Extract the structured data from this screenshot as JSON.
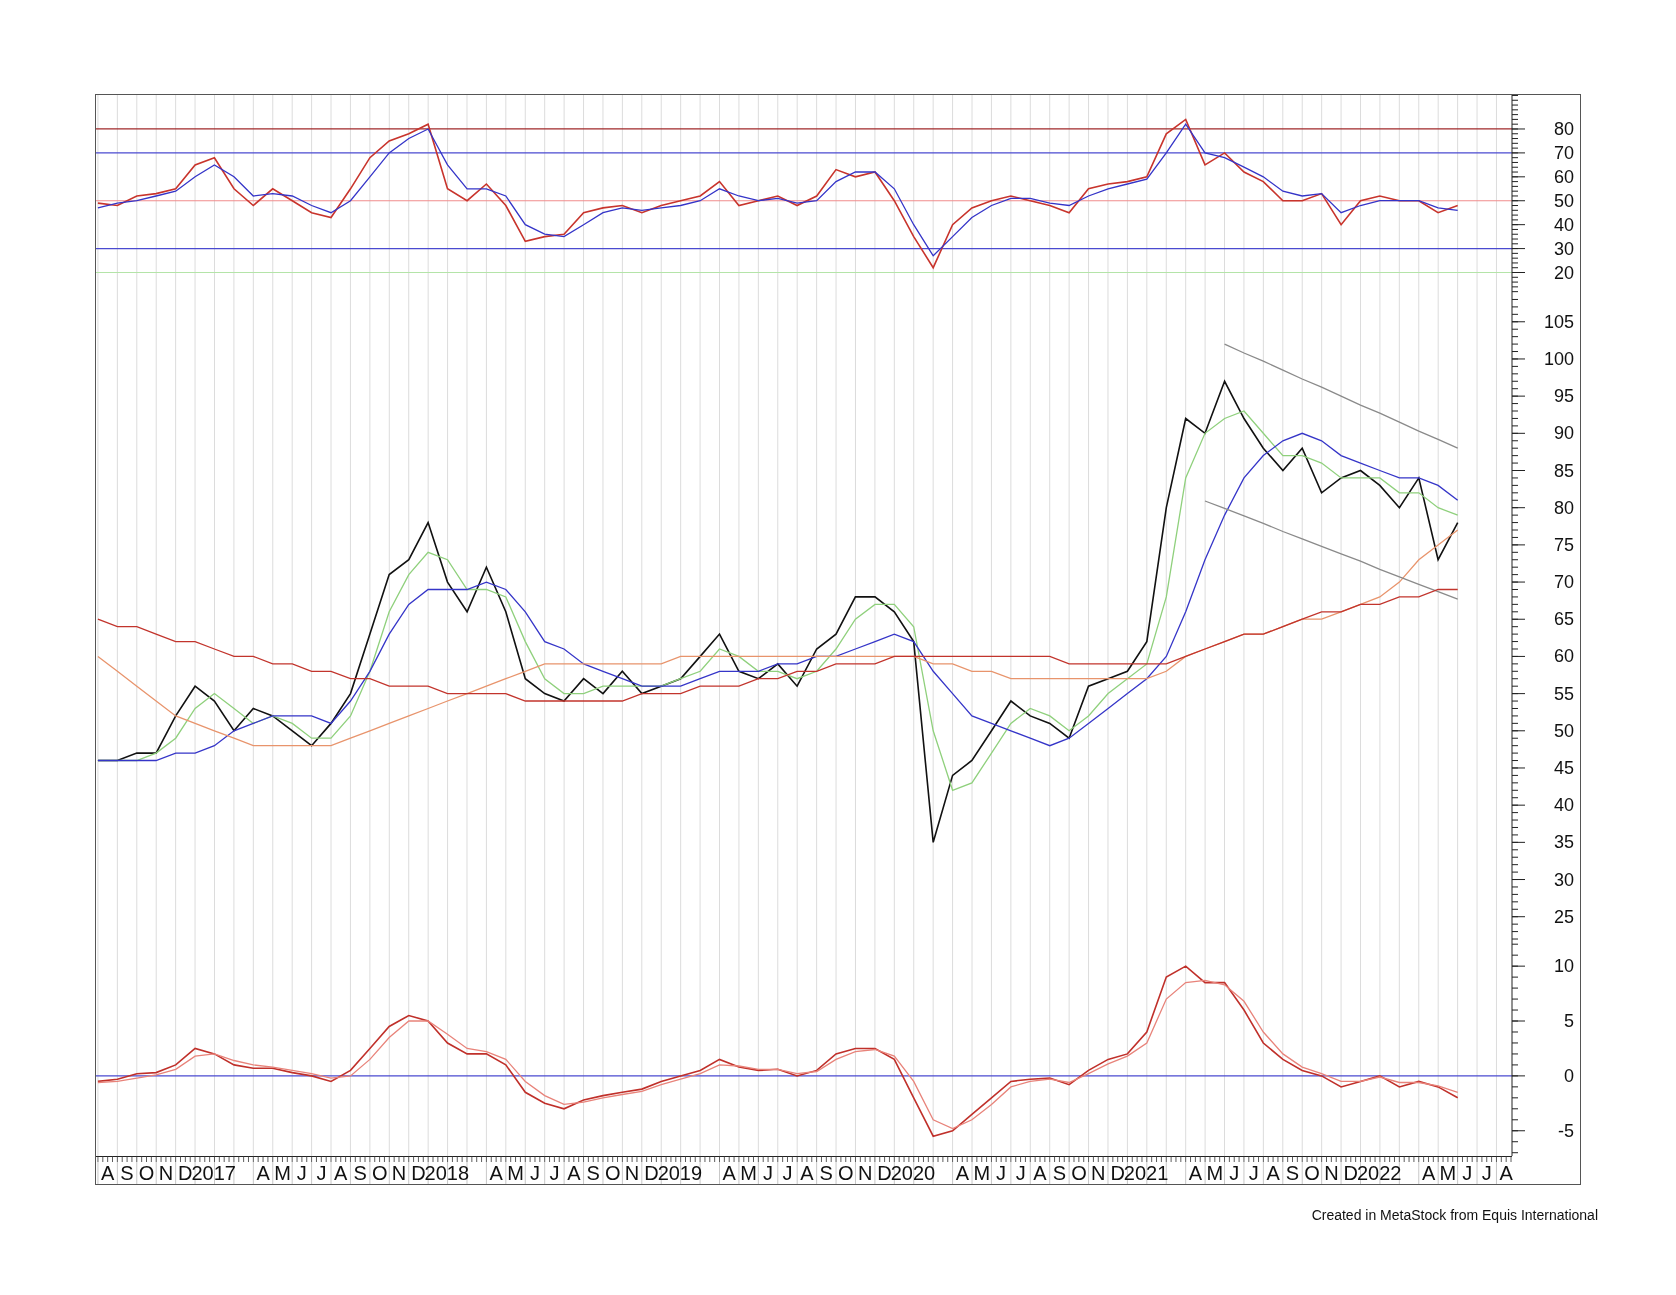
{
  "panels": [
    {
      "chart_data": {
        "type": "line",
        "x": [
          2016.583,
          2016.667,
          2016.75,
          2016.833,
          2016.917,
          2017.0,
          2017.083,
          2017.167,
          2017.25,
          2017.333,
          2017.417,
          2017.5,
          2017.583,
          2017.667,
          2017.75,
          2017.833,
          2017.917,
          2018.0,
          2018.083,
          2018.167,
          2018.25,
          2018.333,
          2018.417,
          2018.5,
          2018.583,
          2018.667,
          2018.75,
          2018.833,
          2018.917,
          2019.0,
          2019.083,
          2019.167,
          2019.25,
          2019.333,
          2019.417,
          2019.5,
          2019.583,
          2019.667,
          2019.75,
          2019.833,
          2019.917,
          2020.0,
          2020.083,
          2020.167,
          2020.25,
          2020.333,
          2020.417,
          2020.5,
          2020.583,
          2020.667,
          2020.75,
          2020.833,
          2020.917,
          2021.0,
          2021.083,
          2021.167,
          2021.25,
          2021.333,
          2021.417,
          2021.5,
          2021.583,
          2021.667,
          2021.75,
          2021.833,
          2021.917,
          2022.0,
          2022.083,
          2022.167,
          2022.25,
          2022.333,
          2022.417
        ],
        "xlim": [
          2016.575,
          2022.65
        ],
        "ylim": [
          10.6,
          94.2
        ],
        "yticks": [
          20,
          30,
          40,
          50,
          60,
          70,
          80
        ],
        "series": [
          {
            "color": "#c8342c",
            "values": [
              49,
              48,
              52,
              53,
              55,
              65,
              68,
              55,
              48,
              55,
              50,
              45,
              43,
              55,
              68,
              75,
              78,
              82,
              55,
              50,
              57,
              48,
              33,
              35,
              36,
              45,
              47,
              48,
              45,
              48,
              50,
              52,
              58,
              48,
              50,
              52,
              48,
              52,
              63,
              60,
              62,
              50,
              35,
              22,
              40,
              47,
              50,
              52,
              50,
              48,
              45,
              55,
              57,
              58,
              60,
              78,
              84,
              65,
              70,
              62,
              58,
              50,
              50,
              53,
              40,
              50,
              52,
              50,
              50,
              45,
              48
            ]
          },
          {
            "color": "#3434c8",
            "values": [
              47,
              49,
              50,
              52,
              54,
              60,
              65,
              60,
              52,
              53,
              52,
              48,
              45,
              50,
              60,
              70,
              76,
              80,
              65,
              55,
              55,
              52,
              40,
              36,
              35,
              40,
              45,
              47,
              46,
              47,
              48,
              50,
              55,
              52,
              50,
              51,
              49,
              50,
              58,
              62,
              62,
              55,
              40,
              27,
              35,
              43,
              48,
              51,
              51,
              49,
              48,
              52,
              55,
              57,
              59,
              70,
              82,
              70,
              68,
              64,
              60,
              54,
              52,
              53,
              45,
              48,
              50,
              50,
              50,
              47,
              46
            ]
          }
        ],
        "grid": true,
        "ref_lines": [
          {
            "axis": "y",
            "value": 80,
            "color": "#a0282a"
          },
          {
            "axis": "y",
            "value": 70,
            "color": "#4a4ad0"
          },
          {
            "axis": "y",
            "value": 50,
            "color": "#f08c8c"
          },
          {
            "axis": "y",
            "value": 30,
            "color": "#4a4ad0"
          },
          {
            "axis": "y",
            "value": 20,
            "color": "#b4e4a8"
          }
        ]
      }
    },
    {
      "chart_data": {
        "type": "line",
        "x": [
          2016.583,
          2016.667,
          2016.75,
          2016.833,
          2016.917,
          2017.0,
          2017.083,
          2017.167,
          2017.25,
          2017.333,
          2017.417,
          2017.5,
          2017.583,
          2017.667,
          2017.75,
          2017.833,
          2017.917,
          2018.0,
          2018.083,
          2018.167,
          2018.25,
          2018.333,
          2018.417,
          2018.5,
          2018.583,
          2018.667,
          2018.75,
          2018.833,
          2018.917,
          2019.0,
          2019.083,
          2019.167,
          2019.25,
          2019.333,
          2019.417,
          2019.5,
          2019.583,
          2019.667,
          2019.75,
          2019.833,
          2019.917,
          2020.0,
          2020.083,
          2020.167,
          2020.25,
          2020.333,
          2020.417,
          2020.5,
          2020.583,
          2020.667,
          2020.75,
          2020.833,
          2020.917,
          2021.0,
          2021.083,
          2021.167,
          2021.25,
          2021.333,
          2021.417,
          2021.5,
          2021.583,
          2021.667,
          2021.75,
          2021.833,
          2021.917,
          2022.0,
          2022.083,
          2022.167,
          2022.25,
          2022.333,
          2022.417
        ],
        "xlim": [
          2016.575,
          2022.65
        ],
        "ylim": [
          21.6,
          108.6
        ],
        "grid": true,
        "yticks": [
          25,
          30,
          35,
          40,
          45,
          50,
          55,
          60,
          65,
          70,
          75,
          80,
          85,
          90,
          95,
          100,
          105
        ],
        "series": [
          {
            "color": "#111111",
            "values": [
              46,
              46,
              47,
              47,
              52,
              56,
              54,
              50,
              53,
              52,
              50,
              48,
              51,
              55,
              63,
              71,
              73,
              78,
              70,
              66,
              72,
              66,
              57,
              55,
              54,
              57,
              55,
              58,
              55,
              56,
              57,
              60,
              63,
              58,
              57,
              59,
              56,
              61,
              63,
              68,
              68,
              66,
              62,
              35,
              44,
              46,
              50,
              54,
              52,
              51,
              49,
              56,
              57,
              58,
              62,
              80,
              92,
              90,
              97,
              92,
              88,
              85,
              88,
              82,
              84,
              85,
              83,
              80,
              84,
              73,
              78
            ]
          },
          {
            "color": "#8fd07c",
            "values": [
              46,
              46,
              46,
              47,
              49,
              53,
              55,
              53,
              51,
              52,
              51,
              49,
              49,
              52,
              58,
              66,
              71,
              74,
              73,
              69,
              69,
              68,
              62,
              57,
              55,
              55,
              56,
              56,
              56,
              56,
              57,
              58,
              61,
              60,
              58,
              58,
              57,
              58,
              61,
              65,
              67,
              67,
              64,
              50,
              42,
              43,
              47,
              51,
              53,
              52,
              50,
              52,
              55,
              57,
              59,
              68,
              84,
              90,
              92,
              93,
              90,
              87,
              87,
              86,
              84,
              84,
              84,
              82,
              82,
              80,
              79
            ]
          },
          {
            "color": "#3535c8",
            "values": [
              46,
              46,
              46,
              46,
              47,
              47,
              48,
              50,
              51,
              52,
              52,
              52,
              51,
              54,
              58,
              63,
              67,
              69,
              69,
              69,
              70,
              69,
              66,
              62,
              61,
              59,
              58,
              57,
              56,
              56,
              56,
              57,
              58,
              58,
              58,
              59,
              59,
              60,
              60,
              61,
              62,
              63,
              62,
              58,
              55,
              52,
              51,
              50,
              49,
              48,
              49,
              51,
              53,
              55,
              57,
              60,
              66,
              73,
              79,
              84,
              87,
              89,
              90,
              89,
              87,
              86,
              85,
              84,
              84,
              83,
              81
            ]
          },
          {
            "color": "#e8946c",
            "values": [
              60,
              58,
              56,
              54,
              52,
              51,
              50,
              49,
              48,
              48,
              48,
              48,
              48,
              49,
              50,
              51,
              52,
              53,
              54,
              55,
              56,
              57,
              58,
              59,
              59,
              59,
              59,
              59,
              59,
              59,
              60,
              60,
              60,
              60,
              60,
              60,
              60,
              60,
              60,
              60,
              60,
              60,
              60,
              59,
              59,
              58,
              58,
              57,
              57,
              57,
              57,
              57,
              57,
              57,
              57,
              58,
              60,
              61,
              62,
              63,
              63,
              64,
              65,
              65,
              66,
              67,
              68,
              70,
              73,
              75,
              77
            ]
          },
          {
            "color": "#8a8a8a",
            "values": [
              null,
              null,
              null,
              null,
              null,
              null,
              null,
              null,
              null,
              null,
              null,
              null,
              null,
              null,
              null,
              null,
              null,
              null,
              null,
              null,
              null,
              null,
              null,
              null,
              null,
              null,
              null,
              null,
              null,
              null,
              null,
              null,
              null,
              null,
              null,
              null,
              null,
              null,
              null,
              null,
              null,
              null,
              null,
              null,
              null,
              null,
              null,
              null,
              null,
              null,
              null,
              null,
              null,
              null,
              null,
              null,
              null,
              null,
              102.0,
              100.8,
              99.7,
              98.5,
              97.3,
              96.2,
              95.0,
              93.8,
              92.7,
              91.5,
              90.3,
              89.2,
              88.0
            ]
          },
          {
            "color": "#8a8a8a",
            "values": [
              null,
              null,
              null,
              null,
              null,
              null,
              null,
              null,
              null,
              null,
              null,
              null,
              null,
              null,
              null,
              null,
              null,
              null,
              null,
              null,
              null,
              null,
              null,
              null,
              null,
              null,
              null,
              null,
              null,
              null,
              null,
              null,
              null,
              null,
              null,
              null,
              null,
              null,
              null,
              null,
              null,
              null,
              null,
              null,
              null,
              null,
              null,
              null,
              null,
              null,
              null,
              null,
              null,
              null,
              null,
              null,
              null,
              80.9,
              79.9,
              78.9,
              77.9,
              76.8,
              75.8,
              74.8,
              73.8,
              72.8,
              71.7,
              70.7,
              69.7,
              68.7,
              67.7
            ]
          },
          {
            "color": "#c2342c",
            "values": [
              65,
              64,
              64,
              63,
              62,
              62,
              61,
              60,
              60,
              59,
              59,
              58,
              58,
              57,
              57,
              56,
              56,
              56,
              55,
              55,
              55,
              55,
              54,
              54,
              54,
              54,
              54,
              54,
              55,
              55,
              55,
              56,
              56,
              56,
              57,
              57,
              58,
              58,
              59,
              59,
              59,
              60,
              60,
              60,
              60,
              60,
              60,
              60,
              60,
              60,
              59,
              59,
              59,
              59,
              59,
              59,
              60,
              61,
              62,
              63,
              63,
              64,
              65,
              66,
              66,
              67,
              67,
              68,
              68,
              69,
              69
            ]
          }
        ]
      }
    },
    {
      "chart_data": {
        "type": "line",
        "x": [
          2016.583,
          2016.667,
          2016.75,
          2016.833,
          2016.917,
          2017.0,
          2017.083,
          2017.167,
          2017.25,
          2017.333,
          2017.417,
          2017.5,
          2017.583,
          2017.667,
          2017.75,
          2017.833,
          2017.917,
          2018.0,
          2018.083,
          2018.167,
          2018.25,
          2018.333,
          2018.417,
          2018.5,
          2018.583,
          2018.667,
          2018.75,
          2018.833,
          2018.917,
          2019.0,
          2019.083,
          2019.167,
          2019.25,
          2019.333,
          2019.417,
          2019.5,
          2019.583,
          2019.667,
          2019.75,
          2019.833,
          2019.917,
          2020.0,
          2020.083,
          2020.167,
          2020.25,
          2020.333,
          2020.417,
          2020.5,
          2020.583,
          2020.667,
          2020.75,
          2020.833,
          2020.917,
          2021.0,
          2021.083,
          2021.167,
          2021.25,
          2021.333,
          2021.417,
          2021.5,
          2021.583,
          2021.667,
          2021.75,
          2021.833,
          2021.917,
          2022.0,
          2022.083,
          2022.167,
          2022.25,
          2022.333,
          2022.417
        ],
        "xlim": [
          2016.575,
          2022.65
        ],
        "ylim": [
          -7.3,
          12.2
        ],
        "yticks": [
          -5,
          0,
          5,
          10
        ],
        "xticks": [
          {
            "value": 2016.625,
            "label": "A"
          },
          {
            "value": 2016.708,
            "label": "S"
          },
          {
            "value": 2016.792,
            "label": "O"
          },
          {
            "value": 2016.875,
            "label": "N"
          },
          {
            "value": 2016.958,
            "label": "D"
          },
          {
            "value": 2017.08,
            "label": "2017"
          },
          {
            "value": 2017.292,
            "label": "A"
          },
          {
            "value": 2017.375,
            "label": "M"
          },
          {
            "value": 2017.458,
            "label": "J"
          },
          {
            "value": 2017.542,
            "label": "J"
          },
          {
            "value": 2017.625,
            "label": "A"
          },
          {
            "value": 2017.708,
            "label": "S"
          },
          {
            "value": 2017.792,
            "label": "O"
          },
          {
            "value": 2017.875,
            "label": "N"
          },
          {
            "value": 2017.958,
            "label": "D"
          },
          {
            "value": 2018.08,
            "label": "2018"
          },
          {
            "value": 2018.292,
            "label": "A"
          },
          {
            "value": 2018.375,
            "label": "M"
          },
          {
            "value": 2018.458,
            "label": "J"
          },
          {
            "value": 2018.542,
            "label": "J"
          },
          {
            "value": 2018.625,
            "label": "A"
          },
          {
            "value": 2018.708,
            "label": "S"
          },
          {
            "value": 2018.792,
            "label": "O"
          },
          {
            "value": 2018.875,
            "label": "N"
          },
          {
            "value": 2018.958,
            "label": "D"
          },
          {
            "value": 2019.08,
            "label": "2019"
          },
          {
            "value": 2019.292,
            "label": "A"
          },
          {
            "value": 2019.375,
            "label": "M"
          },
          {
            "value": 2019.458,
            "label": "J"
          },
          {
            "value": 2019.542,
            "label": "J"
          },
          {
            "value": 2019.625,
            "label": "A"
          },
          {
            "value": 2019.708,
            "label": "S"
          },
          {
            "value": 2019.792,
            "label": "O"
          },
          {
            "value": 2019.875,
            "label": "N"
          },
          {
            "value": 2019.958,
            "label": "D"
          },
          {
            "value": 2020.08,
            "label": "2020"
          },
          {
            "value": 2020.292,
            "label": "A"
          },
          {
            "value": 2020.375,
            "label": "M"
          },
          {
            "value": 2020.458,
            "label": "J"
          },
          {
            "value": 2020.542,
            "label": "J"
          },
          {
            "value": 2020.625,
            "label": "A"
          },
          {
            "value": 2020.708,
            "label": "S"
          },
          {
            "value": 2020.792,
            "label": "O"
          },
          {
            "value": 2020.875,
            "label": "N"
          },
          {
            "value": 2020.958,
            "label": "D"
          },
          {
            "value": 2021.08,
            "label": "2021"
          },
          {
            "value": 2021.292,
            "label": "A"
          },
          {
            "value": 2021.375,
            "label": "M"
          },
          {
            "value": 2021.458,
            "label": "J"
          },
          {
            "value": 2021.542,
            "label": "J"
          },
          {
            "value": 2021.625,
            "label": "A"
          },
          {
            "value": 2021.708,
            "label": "S"
          },
          {
            "value": 2021.792,
            "label": "O"
          },
          {
            "value": 2021.875,
            "label": "N"
          },
          {
            "value": 2021.958,
            "label": "D"
          },
          {
            "value": 2022.08,
            "label": "2022"
          },
          {
            "value": 2022.292,
            "label": "A"
          },
          {
            "value": 2022.375,
            "label": "M"
          },
          {
            "value": 2022.458,
            "label": "J"
          },
          {
            "value": 2022.542,
            "label": "J"
          },
          {
            "value": 2022.625,
            "label": "A"
          }
        ],
        "series": [
          {
            "color": "#c0302a",
            "values": [
              -0.5,
              -0.3,
              0.2,
              0.3,
              1,
              2.5,
              2,
              1,
              0.7,
              0.7,
              0.3,
              0,
              -0.5,
              0.5,
              2.5,
              4.5,
              5.5,
              5,
              3,
              2,
              2,
              1,
              -1.5,
              -2.5,
              -3,
              -2.2,
              -1.8,
              -1.5,
              -1.2,
              -0.5,
              0,
              0.5,
              1.5,
              0.8,
              0.5,
              0.6,
              0,
              0.5,
              2,
              2.5,
              2.5,
              1.5,
              -2,
              -5.5,
              -5,
              -3.5,
              -2,
              -0.5,
              -0.3,
              -0.2,
              -0.8,
              0.5,
              1.5,
              2,
              4,
              9,
              10,
              8.5,
              8.5,
              6,
              3,
              1.5,
              0.5,
              0,
              -1,
              -0.5,
              0,
              -1,
              -0.5,
              -1,
              -2
            ]
          },
          {
            "color": "#e8837a",
            "values": [
              -0.6,
              -0.5,
              -0.2,
              0.1,
              0.6,
              1.8,
              2,
              1.4,
              1,
              0.8,
              0.5,
              0.2,
              -0.2,
              0,
              1.5,
              3.5,
              5,
              5,
              3.8,
              2.5,
              2.2,
              1.5,
              -0.5,
              -1.8,
              -2.6,
              -2.4,
              -2,
              -1.7,
              -1.4,
              -0.8,
              -0.3,
              0.2,
              1,
              0.9,
              0.6,
              0.6,
              0.2,
              0.4,
              1.5,
              2.2,
              2.4,
              1.8,
              -0.5,
              -4,
              -4.8,
              -4,
              -2.6,
              -1,
              -0.5,
              -0.3,
              -0.6,
              0.2,
              1.1,
              1.8,
              3,
              7,
              8.5,
              8.7,
              8.3,
              6.8,
              4,
              2,
              0.8,
              0.2,
              -0.5,
              -0.5,
              -0.1,
              -0.6,
              -0.6,
              -0.9,
              -1.5
            ]
          }
        ],
        "grid": true,
        "ref_lines": [
          {
            "axis": "y",
            "value": 0,
            "color": "#4a4ad0"
          }
        ]
      }
    }
  ],
  "footer": "Created in MetaStock from Equis International"
}
